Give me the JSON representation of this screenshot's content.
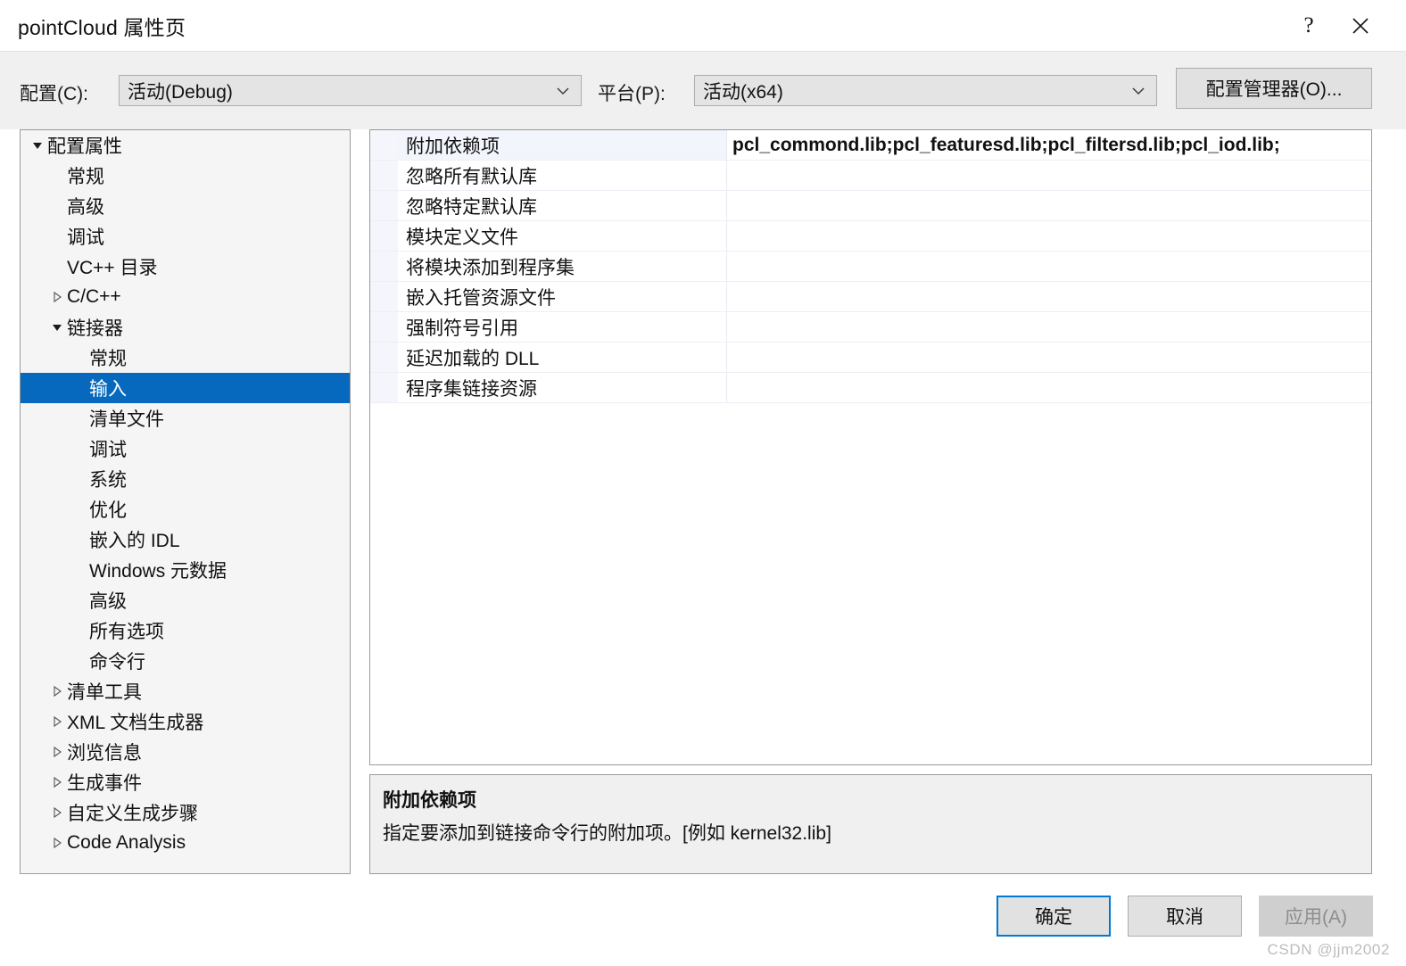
{
  "window": {
    "title": "pointCloud 属性页",
    "help_icon": "question-mark-icon",
    "close_icon": "close-icon"
  },
  "config_bar": {
    "configuration_label": "配置(C):",
    "configuration_value": "活动(Debug)",
    "platform_label": "平台(P):",
    "platform_value": "活动(x64)",
    "config_manager_button": "配置管理器(O)...",
    "dropdown_icon": "chevron-down-icon"
  },
  "tree": {
    "items": [
      {
        "label": "配置属性",
        "level": 0,
        "expander": "expanded",
        "selected": false
      },
      {
        "label": "常规",
        "level": 1,
        "expander": "none",
        "selected": false
      },
      {
        "label": "高级",
        "level": 1,
        "expander": "none",
        "selected": false
      },
      {
        "label": "调试",
        "level": 1,
        "expander": "none",
        "selected": false
      },
      {
        "label": "VC++ 目录",
        "level": 1,
        "expander": "none",
        "selected": false
      },
      {
        "label": "C/C++",
        "level": 1,
        "expander": "collapsed",
        "selected": false
      },
      {
        "label": "链接器",
        "level": 1,
        "expander": "expanded",
        "selected": false
      },
      {
        "label": "常规",
        "level": 2,
        "expander": "none",
        "selected": false
      },
      {
        "label": "输入",
        "level": 2,
        "expander": "none",
        "selected": true
      },
      {
        "label": "清单文件",
        "level": 2,
        "expander": "none",
        "selected": false
      },
      {
        "label": "调试",
        "level": 2,
        "expander": "none",
        "selected": false
      },
      {
        "label": "系统",
        "level": 2,
        "expander": "none",
        "selected": false
      },
      {
        "label": "优化",
        "level": 2,
        "expander": "none",
        "selected": false
      },
      {
        "label": "嵌入的 IDL",
        "level": 2,
        "expander": "none",
        "selected": false
      },
      {
        "label": "Windows 元数据",
        "level": 2,
        "expander": "none",
        "selected": false
      },
      {
        "label": "高级",
        "level": 2,
        "expander": "none",
        "selected": false
      },
      {
        "label": "所有选项",
        "level": 2,
        "expander": "none",
        "selected": false
      },
      {
        "label": "命令行",
        "level": 2,
        "expander": "none",
        "selected": false
      },
      {
        "label": "清单工具",
        "level": 1,
        "expander": "collapsed",
        "selected": false
      },
      {
        "label": "XML 文档生成器",
        "level": 1,
        "expander": "collapsed",
        "selected": false
      },
      {
        "label": "浏览信息",
        "level": 1,
        "expander": "collapsed",
        "selected": false
      },
      {
        "label": "生成事件",
        "level": 1,
        "expander": "collapsed",
        "selected": false
      },
      {
        "label": "自定义生成步骤",
        "level": 1,
        "expander": "collapsed",
        "selected": false
      },
      {
        "label": "Code Analysis",
        "level": 1,
        "expander": "collapsed",
        "selected": false
      }
    ]
  },
  "property_grid": {
    "rows": [
      {
        "label": "附加依赖项",
        "value": "pcl_commond.lib;pcl_featuresd.lib;pcl_filtersd.lib;pcl_iod.lib;",
        "active": true
      },
      {
        "label": "忽略所有默认库",
        "value": "",
        "active": false
      },
      {
        "label": "忽略特定默认库",
        "value": "",
        "active": false
      },
      {
        "label": "模块定义文件",
        "value": "",
        "active": false
      },
      {
        "label": "将模块添加到程序集",
        "value": "",
        "active": false
      },
      {
        "label": "嵌入托管资源文件",
        "value": "",
        "active": false
      },
      {
        "label": "强制符号引用",
        "value": "",
        "active": false
      },
      {
        "label": "延迟加载的 DLL",
        "value": "",
        "active": false
      },
      {
        "label": "程序集链接资源",
        "value": "",
        "active": false
      }
    ]
  },
  "description": {
    "title": "附加依赖项",
    "text": "指定要添加到链接命令行的附加项。[例如 kernel32.lib]"
  },
  "footer": {
    "ok": "确定",
    "cancel": "取消",
    "apply": "应用(A)"
  },
  "watermark": "CSDN @jjm2002",
  "colors": {
    "selection_blue": "#0769bd",
    "focus_border": "#0078d7",
    "dialog_gray": "#f0f0f0",
    "panel_border": "#9a9a9a"
  }
}
